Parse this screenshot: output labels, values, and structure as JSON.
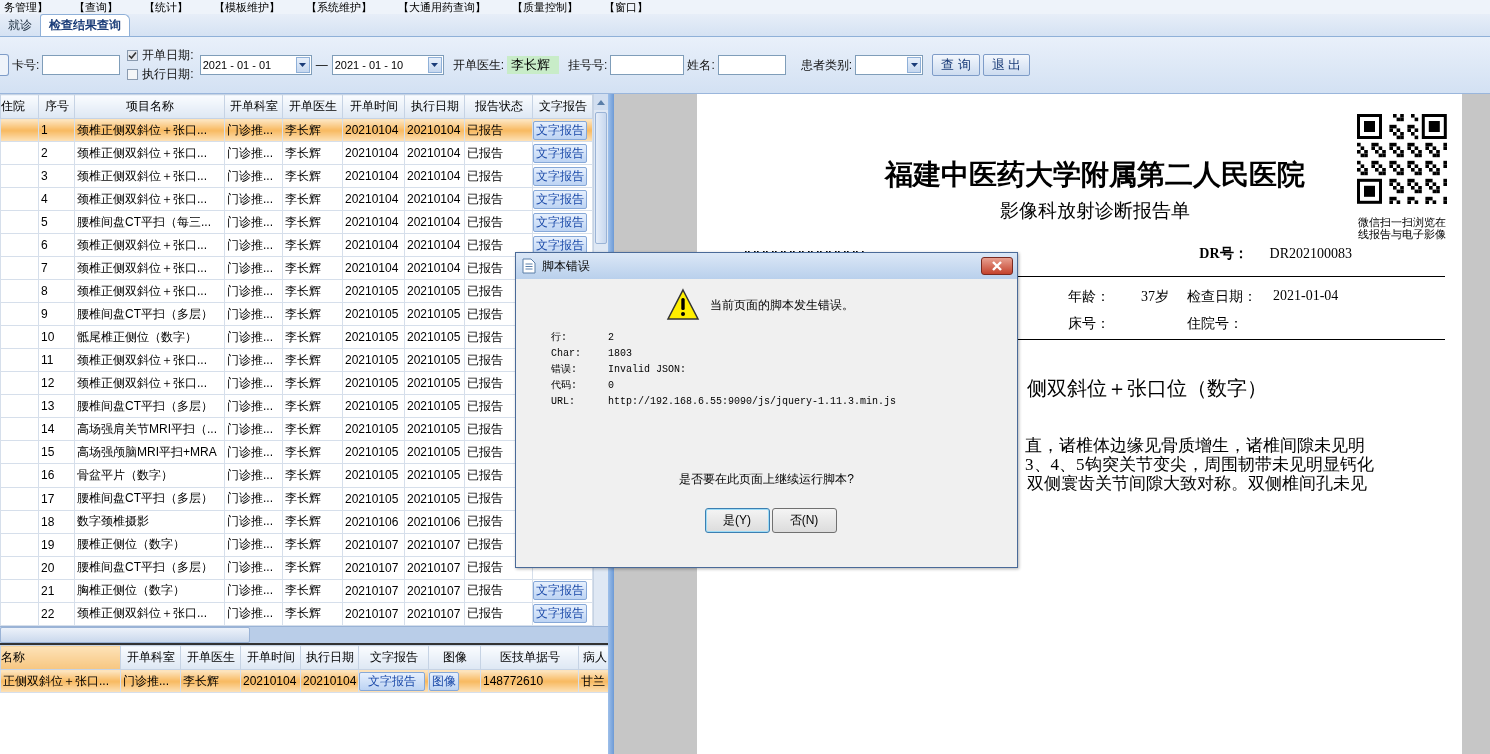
{
  "menu": [
    "务管理】",
    "【查询】",
    "【统计】",
    "【模板维护】",
    "【系统维护】",
    "【大通用药查询】",
    "【质量控制】",
    "【窗口】"
  ],
  "tabs": [
    {
      "label": "就诊",
      "selected": false
    },
    {
      "label": "检查结果查询",
      "selected": true
    }
  ],
  "toolbar": {
    "card_label": "卡号:",
    "date_options": [
      {
        "label": "开单日期:",
        "checked": true
      },
      {
        "label": "执行日期:",
        "checked": false
      }
    ],
    "date_from": "2021 - 01 - 01",
    "date_sep": "—",
    "date_to": "2021 - 01 - 10",
    "doctor_label": "开单医生:",
    "doctor_value": "李长辉",
    "reg_label": "挂号号:",
    "name_label": "姓名:",
    "type_label": "患者类别:",
    "buttons": [
      "查 询",
      "退 出"
    ]
  },
  "orders": {
    "columns": [
      "住院",
      "序号",
      "项目名称",
      "开单科室",
      "开单医生",
      "开单时间",
      "执行日期",
      "报告状态",
      "文字报告"
    ],
    "rows": [
      {
        "cells": [
          "",
          "1",
          "颈椎正侧双斜位＋张口...",
          "门诊推...",
          "李长辉",
          "20210104",
          "20210104",
          "已报告"
        ],
        "report_button": "文字报告",
        "selected": true
      },
      {
        "cells": [
          "",
          "2",
          "颈椎正侧双斜位＋张口...",
          "门诊推...",
          "李长辉",
          "20210104",
          "20210104",
          "已报告"
        ],
        "report_button": "文字报告",
        "selected": false
      },
      {
        "cells": [
          "",
          "3",
          "颈椎正侧双斜位＋张口...",
          "门诊推...",
          "李长辉",
          "20210104",
          "20210104",
          "已报告"
        ],
        "report_button": "文字报告",
        "selected": false
      },
      {
        "cells": [
          "",
          "4",
          "颈椎正侧双斜位＋张口...",
          "门诊推...",
          "李长辉",
          "20210104",
          "20210104",
          "已报告"
        ],
        "report_button": "文字报告",
        "selected": false
      },
      {
        "cells": [
          "",
          "5",
          "腰椎间盘CT平扫（每三...",
          "门诊推...",
          "李长辉",
          "20210104",
          "20210104",
          "已报告"
        ],
        "report_button": "文字报告",
        "selected": false
      },
      {
        "cells": [
          "",
          "6",
          "颈椎正侧双斜位＋张口...",
          "门诊推...",
          "李长辉",
          "20210104",
          "20210104",
          "已报告"
        ],
        "report_button": "文字报告",
        "selected": false
      },
      {
        "cells": [
          "",
          "7",
          "颈椎正侧双斜位＋张口...",
          "门诊推...",
          "李长辉",
          "20210104",
          "20210104",
          "已报告"
        ],
        "selected": false
      },
      {
        "cells": [
          "",
          "8",
          "颈椎正侧双斜位＋张口...",
          "门诊推...",
          "李长辉",
          "20210105",
          "20210105",
          "已报告"
        ],
        "selected": false
      },
      {
        "cells": [
          "",
          "9",
          "腰椎间盘CT平扫（多层）",
          "门诊推...",
          "李长辉",
          "20210105",
          "20210105",
          "已报告"
        ],
        "selected": false
      },
      {
        "cells": [
          "",
          "10",
          "骶尾椎正侧位（数字）",
          "门诊推...",
          "李长辉",
          "20210105",
          "20210105",
          "已报告"
        ],
        "selected": false
      },
      {
        "cells": [
          "",
          "11",
          "颈椎正侧双斜位＋张口...",
          "门诊推...",
          "李长辉",
          "20210105",
          "20210105",
          "已报告"
        ],
        "selected": false
      },
      {
        "cells": [
          "",
          "12",
          "颈椎正侧双斜位＋张口...",
          "门诊推...",
          "李长辉",
          "20210105",
          "20210105",
          "已报告"
        ],
        "selected": false
      },
      {
        "cells": [
          "",
          "13",
          "腰椎间盘CT平扫（多层）",
          "门诊推...",
          "李长辉",
          "20210105",
          "20210105",
          "已报告"
        ],
        "selected": false
      },
      {
        "cells": [
          "",
          "14",
          "高场强肩关节MRI平扫（...",
          "门诊推...",
          "李长辉",
          "20210105",
          "20210105",
          "已报告"
        ],
        "selected": false
      },
      {
        "cells": [
          "",
          "15",
          "高场强颅脑MRI平扫+MRA",
          "门诊推...",
          "李长辉",
          "20210105",
          "20210105",
          "已报告"
        ],
        "selected": false
      },
      {
        "cells": [
          "",
          "16",
          "骨盆平片（数字）",
          "门诊推...",
          "李长辉",
          "20210105",
          "20210105",
          "已报告"
        ],
        "selected": false
      },
      {
        "cells": [
          "",
          "17",
          "腰椎间盘CT平扫（多层）",
          "门诊推...",
          "李长辉",
          "20210105",
          "20210105",
          "已报告"
        ],
        "selected": false
      },
      {
        "cells": [
          "",
          "18",
          "数字颈椎摄影",
          "门诊推...",
          "李长辉",
          "20210106",
          "20210106",
          "已报告"
        ],
        "selected": false
      },
      {
        "cells": [
          "",
          "19",
          "腰椎正侧位（数字）",
          "门诊推...",
          "李长辉",
          "20210107",
          "20210107",
          "已报告"
        ],
        "selected": false
      },
      {
        "cells": [
          "",
          "20",
          "腰椎间盘CT平扫（多层）",
          "门诊推...",
          "李长辉",
          "20210107",
          "20210107",
          "已报告"
        ],
        "selected": false
      },
      {
        "cells": [
          "",
          "21",
          "胸椎正侧位（数字）",
          "门诊推...",
          "李长辉",
          "20210107",
          "20210107",
          "已报告"
        ],
        "report_button": "文字报告",
        "selected": false
      },
      {
        "cells": [
          "",
          "22",
          "颈椎正侧双斜位＋张口...",
          "门诊推...",
          "李长辉",
          "20210107",
          "20210107",
          "已报告"
        ],
        "report_button": "文字报告",
        "selected": false
      }
    ]
  },
  "details": {
    "columns": [
      {
        "label": "名称",
        "selected": true
      },
      {
        "label": "开单科室",
        "selected": false
      },
      {
        "label": "开单医生",
        "selected": false
      },
      {
        "label": "开单时间",
        "selected": false
      },
      {
        "label": "执行日期",
        "selected": false
      },
      {
        "label": "文字报告",
        "selected": false
      },
      {
        "label": "图像",
        "selected": false
      },
      {
        "label": "医技单据号",
        "selected": false
      },
      {
        "label": "病人",
        "selected": false
      }
    ],
    "rows": [
      {
        "name": "正侧双斜位＋张口...",
        "dept": "门诊推...",
        "doctor": "李长辉",
        "open": "20210104",
        "exec": "20210104",
        "report_button": "文字报告",
        "image_button": "图像",
        "doc_no": "148772610",
        "patient": "甘兰",
        "selected": true
      }
    ]
  },
  "report": {
    "title": "福建中医药大学附属第二人民医院",
    "subtitle": "影像科放射诊断报告单",
    "qr_caption": [
      "微信扫一扫浏览在",
      "线报告与电子影像"
    ],
    "dr_label": "DR号：",
    "dr_value": "DR202100083",
    "fields": [
      [
        {
          "label": "年龄：",
          "value": "37岁"
        },
        {
          "label": "检查日期：",
          "value": "2021-01-04"
        }
      ],
      [
        {
          "label": "床号："
        },
        {
          "label": "住院号："
        }
      ]
    ],
    "exam": "侧双斜位＋张口位（数字）",
    "findings": [
      "直，诸椎体边缘见骨质增生，诸椎间隙未见明",
      "3、4、5钩突关节变尖，周围韧带未见明显钙化",
      "双侧寰齿关节间隙大致对称。双侧椎间孔未见"
    ]
  },
  "dialog": {
    "title": "脚本错误",
    "message": "当前页面的脚本发生错误。",
    "details": [
      {
        "label": "行:",
        "value": "2"
      },
      {
        "label": "Char:",
        "value": "1803"
      },
      {
        "label": "错误:",
        "value": "Invalid JSON:"
      },
      {
        "label": "代码:",
        "value": "0"
      },
      {
        "label": "URL:",
        "value": "http://192.168.6.55:9090/js/jquery-1.11.3.min.js"
      }
    ],
    "question": "是否要在此页面上继续运行脚本?",
    "buttons": [
      {
        "label": "是(Y)",
        "selected": true
      },
      {
        "label": "否(N)",
        "selected": false
      }
    ]
  }
}
